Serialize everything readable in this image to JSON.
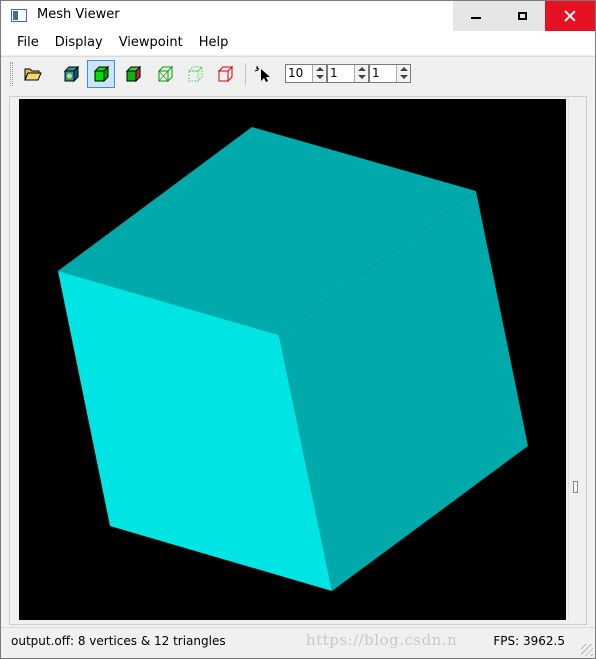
{
  "window": {
    "title": "Mesh Viewer"
  },
  "menu": {
    "items": [
      "File",
      "Display",
      "Viewpoint",
      "Help"
    ]
  },
  "toolbar": {
    "open_icon": "folder-open-icon",
    "render_modes": [
      {
        "icon": "shaded-cube-icon",
        "color": "#0a7a8a"
      },
      {
        "icon": "flat-cube-icon",
        "color": "#00c000",
        "active": true
      },
      {
        "icon": "smooth-cube-icon",
        "color": "#00b000"
      },
      {
        "icon": "wireframe-cube-icon",
        "color": "#00aa00"
      },
      {
        "icon": "points-cube-icon",
        "color": "#44cc44"
      },
      {
        "icon": "hidden-line-cube-icon",
        "color": "#dd0000"
      }
    ],
    "select_icon": "pointer-select-icon",
    "spinners": [
      {
        "value": "10"
      },
      {
        "value": "1"
      },
      {
        "value": "1"
      }
    ]
  },
  "viewport": {
    "background": "#000000",
    "cube_colors": {
      "top": "#00aaaa",
      "front": "#00e4e4",
      "right": "#00aaaa"
    }
  },
  "status": {
    "left": "output.off: 8 vertices & 12 triangles",
    "right": "FPS: 3962.5",
    "watermark": "https://blog.csdn.n"
  }
}
